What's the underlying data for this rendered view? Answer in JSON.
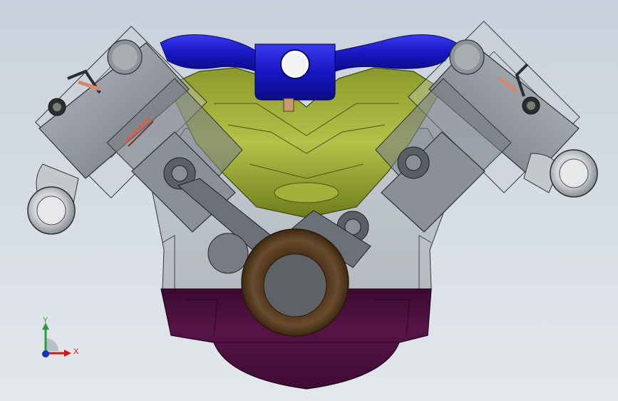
{
  "viewport": {
    "background_top": "#c9d1dc",
    "background_bottom": "#e4e8ec"
  },
  "model": {
    "colors": {
      "intake_manifold": "#1c1cc8",
      "intake_plenum": "#9aab2f",
      "crankshaft_pulley": "#5e4325",
      "oil_pan": "#4a0d3c",
      "cylinder_head": "#8a8f96",
      "exhaust_port": "#bfc3c7",
      "timing_spring": "#c86450"
    }
  },
  "triad": {
    "y_label": "Y",
    "x_label": "X",
    "y_color": "#22a040",
    "x_color": "#d01818",
    "z_color": "#1c2fb8"
  }
}
